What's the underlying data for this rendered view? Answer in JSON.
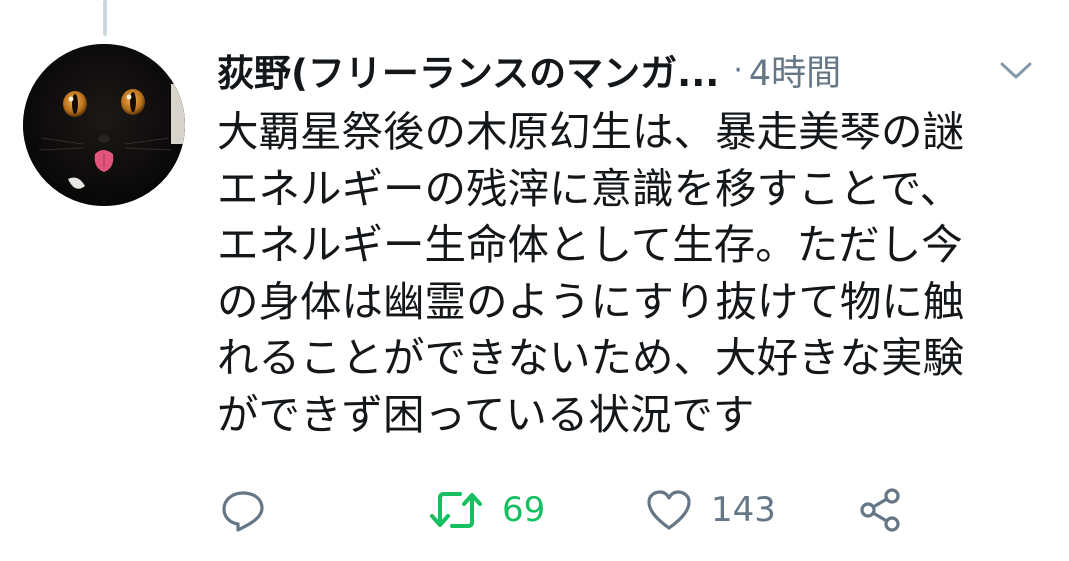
{
  "tweet": {
    "display_name": "荻野(フリーランスのマンガ...",
    "separator": "·",
    "time": "4時間",
    "body_lines": [
      "大覇星祭後の木原幻生は、暴走美琴の謎",
      "エネルギーの残滓に意識を移すことで、",
      "エネルギー生命体として生存。ただし今",
      "の身体は幽霊のようにすり抜けて物に触",
      "れることができないため、大好きな実験",
      "ができず困っている状況です"
    ]
  },
  "actions": {
    "reply": {
      "icon": "reply-icon",
      "count": ""
    },
    "retweet": {
      "icon": "retweet-icon",
      "count": "69",
      "color": "#17bf63",
      "active": true
    },
    "like": {
      "icon": "heart-icon",
      "count": "143",
      "color": "#657786"
    },
    "share": {
      "icon": "share-icon"
    }
  },
  "colors": {
    "text": "#14171a",
    "secondary": "#657786",
    "retweet_active": "#17bf63",
    "thread_line": "#ccd6dd"
  },
  "avatar": {
    "icon": "black-cat-avatar"
  }
}
